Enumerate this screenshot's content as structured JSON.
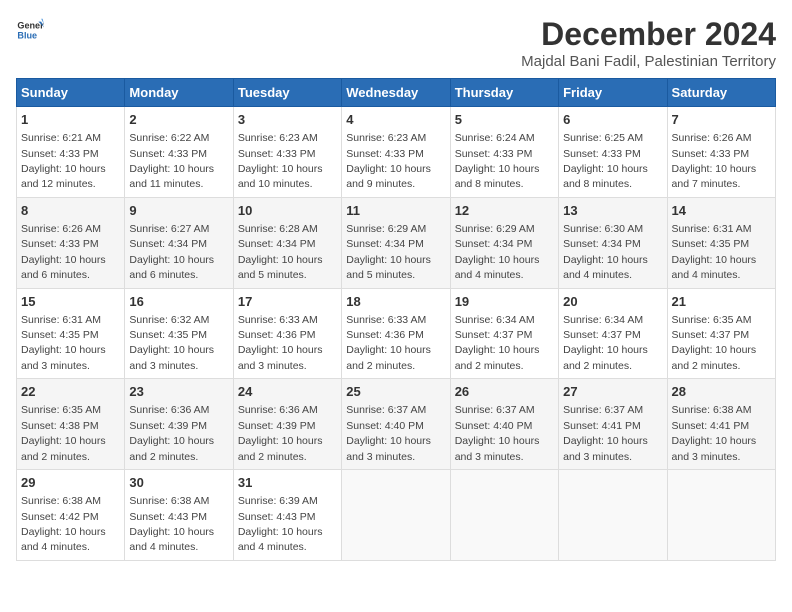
{
  "header": {
    "logo_general": "General",
    "logo_blue": "Blue",
    "title": "December 2024",
    "subtitle": "Majdal Bani Fadil, Palestinian Territory"
  },
  "calendar": {
    "days_of_week": [
      "Sunday",
      "Monday",
      "Tuesday",
      "Wednesday",
      "Thursday",
      "Friday",
      "Saturday"
    ],
    "weeks": [
      [
        null,
        {
          "day": "2",
          "sunrise": "6:22 AM",
          "sunset": "4:33 PM",
          "daylight": "10 hours and 11 minutes."
        },
        {
          "day": "3",
          "sunrise": "6:23 AM",
          "sunset": "4:33 PM",
          "daylight": "10 hours and 10 minutes."
        },
        {
          "day": "4",
          "sunrise": "6:23 AM",
          "sunset": "4:33 PM",
          "daylight": "10 hours and 9 minutes."
        },
        {
          "day": "5",
          "sunrise": "6:24 AM",
          "sunset": "4:33 PM",
          "daylight": "10 hours and 8 minutes."
        },
        {
          "day": "6",
          "sunrise": "6:25 AM",
          "sunset": "4:33 PM",
          "daylight": "10 hours and 8 minutes."
        },
        {
          "day": "7",
          "sunrise": "6:26 AM",
          "sunset": "4:33 PM",
          "daylight": "10 hours and 7 minutes."
        }
      ],
      [
        {
          "day": "1",
          "sunrise": "6:21 AM",
          "sunset": "4:33 PM",
          "daylight": "10 hours and 12 minutes."
        },
        {
          "day": "9",
          "sunrise": "6:27 AM",
          "sunset": "4:34 PM",
          "daylight": "10 hours and 6 minutes."
        },
        {
          "day": "10",
          "sunrise": "6:28 AM",
          "sunset": "4:34 PM",
          "daylight": "10 hours and 5 minutes."
        },
        {
          "day": "11",
          "sunrise": "6:29 AM",
          "sunset": "4:34 PM",
          "daylight": "10 hours and 5 minutes."
        },
        {
          "day": "12",
          "sunrise": "6:29 AM",
          "sunset": "4:34 PM",
          "daylight": "10 hours and 4 minutes."
        },
        {
          "day": "13",
          "sunrise": "6:30 AM",
          "sunset": "4:34 PM",
          "daylight": "10 hours and 4 minutes."
        },
        {
          "day": "14",
          "sunrise": "6:31 AM",
          "sunset": "4:35 PM",
          "daylight": "10 hours and 4 minutes."
        }
      ],
      [
        {
          "day": "8",
          "sunrise": "6:26 AM",
          "sunset": "4:33 PM",
          "daylight": "10 hours and 6 minutes."
        },
        {
          "day": "16",
          "sunrise": "6:32 AM",
          "sunset": "4:35 PM",
          "daylight": "10 hours and 3 minutes."
        },
        {
          "day": "17",
          "sunrise": "6:33 AM",
          "sunset": "4:36 PM",
          "daylight": "10 hours and 3 minutes."
        },
        {
          "day": "18",
          "sunrise": "6:33 AM",
          "sunset": "4:36 PM",
          "daylight": "10 hours and 2 minutes."
        },
        {
          "day": "19",
          "sunrise": "6:34 AM",
          "sunset": "4:37 PM",
          "daylight": "10 hours and 2 minutes."
        },
        {
          "day": "20",
          "sunrise": "6:34 AM",
          "sunset": "4:37 PM",
          "daylight": "10 hours and 2 minutes."
        },
        {
          "day": "21",
          "sunrise": "6:35 AM",
          "sunset": "4:37 PM",
          "daylight": "10 hours and 2 minutes."
        }
      ],
      [
        {
          "day": "15",
          "sunrise": "6:31 AM",
          "sunset": "4:35 PM",
          "daylight": "10 hours and 3 minutes."
        },
        {
          "day": "23",
          "sunrise": "6:36 AM",
          "sunset": "4:39 PM",
          "daylight": "10 hours and 2 minutes."
        },
        {
          "day": "24",
          "sunrise": "6:36 AM",
          "sunset": "4:39 PM",
          "daylight": "10 hours and 2 minutes."
        },
        {
          "day": "25",
          "sunrise": "6:37 AM",
          "sunset": "4:40 PM",
          "daylight": "10 hours and 3 minutes."
        },
        {
          "day": "26",
          "sunrise": "6:37 AM",
          "sunset": "4:40 PM",
          "daylight": "10 hours and 3 minutes."
        },
        {
          "day": "27",
          "sunrise": "6:37 AM",
          "sunset": "4:41 PM",
          "daylight": "10 hours and 3 minutes."
        },
        {
          "day": "28",
          "sunrise": "6:38 AM",
          "sunset": "4:41 PM",
          "daylight": "10 hours and 3 minutes."
        }
      ],
      [
        {
          "day": "22",
          "sunrise": "6:35 AM",
          "sunset": "4:38 PM",
          "daylight": "10 hours and 2 minutes."
        },
        {
          "day": "30",
          "sunrise": "6:38 AM",
          "sunset": "4:43 PM",
          "daylight": "10 hours and 4 minutes."
        },
        {
          "day": "31",
          "sunrise": "6:39 AM",
          "sunset": "4:43 PM",
          "daylight": "10 hours and 4 minutes."
        },
        null,
        null,
        null,
        null
      ],
      [
        {
          "day": "29",
          "sunrise": "6:38 AM",
          "sunset": "4:42 PM",
          "daylight": "10 hours and 4 minutes."
        },
        null,
        null,
        null,
        null,
        null,
        null
      ]
    ]
  }
}
